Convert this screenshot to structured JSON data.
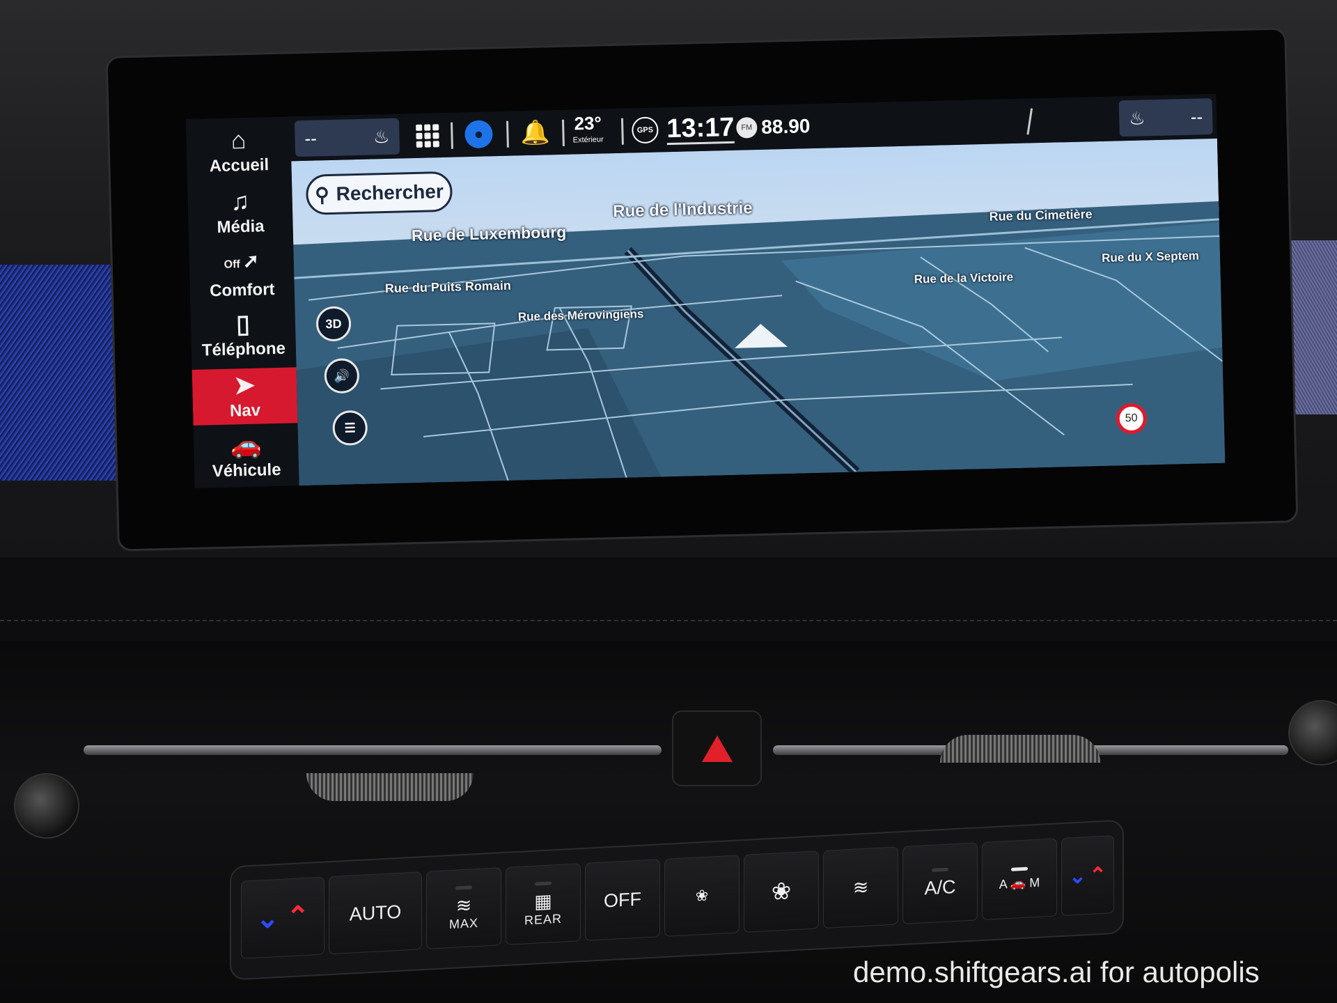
{
  "sidebar": {
    "items": [
      {
        "label": "Accueil",
        "icon": "home-icon"
      },
      {
        "label": "Média",
        "icon": "music-icon"
      },
      {
        "label": "Comfort",
        "icon": "seat-icon",
        "status": "Off"
      },
      {
        "label": "Téléphone",
        "icon": "phone-icon"
      },
      {
        "label": "Nav",
        "icon": "navigation-arrow-icon",
        "active": true
      },
      {
        "label": "Véhicule",
        "icon": "car-icon"
      }
    ]
  },
  "topbar": {
    "left_seat_value": "--",
    "temperature": "23°",
    "temperature_label": "Extérieur",
    "gps_label": "GPS",
    "clock": "13:17",
    "radio_band": "FM",
    "radio_frequency": "88.90",
    "right_seat_value": "--"
  },
  "map": {
    "search_label": "Rechercher",
    "view_mode": "3D",
    "speed_limit": "50",
    "streets": [
      "Rue de l'Industrie",
      "Rue de Luxembourg",
      "Rue du Cimetière",
      "Rue du X Septem",
      "Rue de la Victoire",
      "Rue du Puits Romain",
      "Rue des Mérovingiens"
    ]
  },
  "climate": {
    "auto_label": "AUTO",
    "max_label": "MAX",
    "rear_label": "REAR",
    "off_label": "OFF",
    "ac_label": "A/C",
    "recirc_a": "A",
    "recirc_m": "M"
  },
  "watermark": "demo.shiftgears.ai for autopolis",
  "colors": {
    "accent_red": "#d7192f",
    "map_water": "#2f5470",
    "sky": "#c9dcf0",
    "profile_blue": "#1e73e8"
  }
}
